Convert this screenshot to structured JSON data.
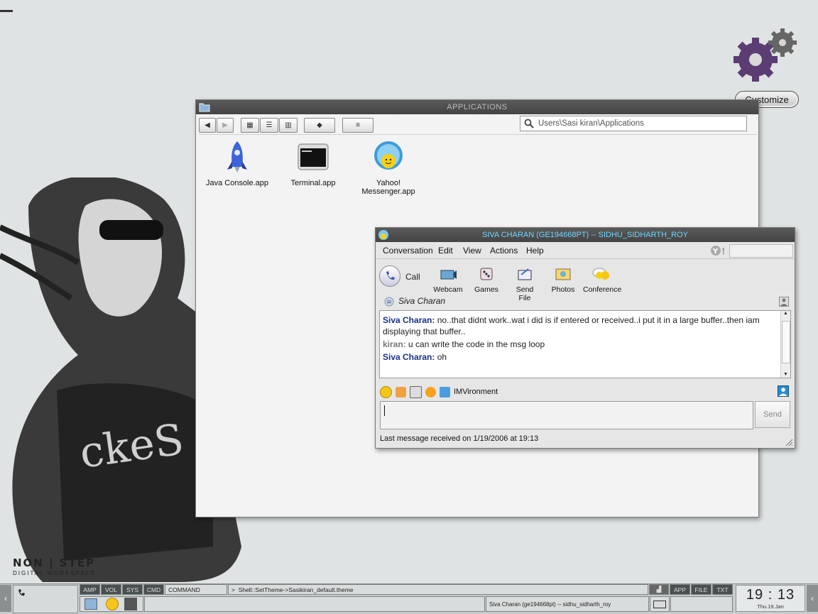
{
  "desktop": {
    "logo": {
      "title": "NON | STEP",
      "subtitle": "DIGITAL WORKSPACE"
    },
    "customize_label": "Customize"
  },
  "app_window": {
    "title": "APPLICATIONS",
    "address": "Users\\Sasi kiran\\Applications",
    "files": [
      {
        "label": "Java Console.app",
        "icon": "rocket-icon"
      },
      {
        "label": "Terminal.app",
        "icon": "terminal-icon"
      },
      {
        "label": "Yahoo! Messenger.app",
        "icon": "yahoo-messenger-icon"
      }
    ]
  },
  "messenger": {
    "title": "SIVA CHARAN (GE194668PT) -- SIDHU_SIDHARTH_ROY",
    "menu": [
      "Conversation",
      "Edit",
      "View",
      "Actions",
      "Help"
    ],
    "call_label": "Call",
    "tools": [
      "Webcam",
      "Games",
      "Send File",
      "Photos",
      "Conference"
    ],
    "contact": "Siva Charan",
    "messages": [
      {
        "sender": "Siva Charan:",
        "text": "no..that didnt work..wat i did is if entered or received..i put it in a large buffer..then iam displaying that buffer.."
      },
      {
        "sender": "kiran:",
        "text": "u can write the code in the msg loop"
      },
      {
        "sender": "Siva Charan:",
        "text": "oh"
      }
    ],
    "imvironment_label": "IMVironment",
    "send_label": "Send",
    "status": "Last message received on 1/19/2006 at 19:13"
  },
  "taskbar": {
    "tabs": [
      "AMP",
      "VOL",
      "SYS",
      "CMD"
    ],
    "command_label": "COMMAND",
    "command_text": "Shell::SetTheme->Sasikiran_default.theme",
    "task_label": "Siva Charan (ge194668pt) -- sidhu_sidharth_roy",
    "right_tabs": [
      "APP",
      "FILE",
      "TXT"
    ],
    "clock_time": "19 : 13",
    "clock_date": "Thu.19.Jan"
  },
  "colors": {
    "titlebar": "#4a4a4a",
    "messenger_title": "#6fd6ff",
    "name_blue": "#1b2f8a"
  }
}
